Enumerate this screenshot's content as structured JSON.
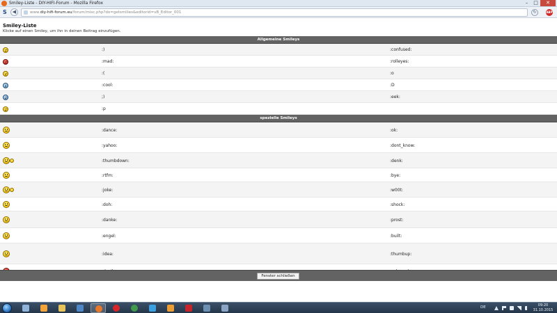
{
  "window": {
    "title": "Smiley-Liste - DIY-HIFI-Forum - Mozilla Firefox",
    "buttons": {
      "minimize": "–",
      "maximize": "□",
      "close": "✕"
    }
  },
  "navbar": {
    "s_label": "S",
    "back_glyph": "◀",
    "url_prefix": "www.",
    "url_domain": "diy-hifi-forum.eu",
    "url_rest": "/forum/misc.php?do=getsmilies&editorid=vB_Editor_001",
    "reload_glyph": "↻",
    "abp_label": "ABP"
  },
  "page": {
    "title": "Smiley-Liste",
    "subtitle": "Klicke auf einen Smiley, um ihn in deinen Beitrag einzufügen.",
    "close_button": "Fenster schließen"
  },
  "sections": [
    {
      "title": "Allgemeine Smileys",
      "rows": [
        {
          "left": {
            "code": ":)",
            "icon": "smile-icon"
          },
          "right": {
            "code": ":confused:",
            "icon": "confused-icon"
          }
        },
        {
          "left": {
            "code": ":mad:",
            "icon": "mad-icon"
          },
          "right": {
            "code": ":rolleyes:",
            "icon": "rolleyes-icon"
          }
        },
        {
          "left": {
            "code": ":(",
            "icon": "frown-icon"
          },
          "right": {
            "code": ":o",
            "icon": "redface-icon"
          }
        },
        {
          "left": {
            "code": ":cool:",
            "icon": "cool-icon"
          },
          "right": {
            "code": ":D",
            "icon": "biggrin-icon"
          }
        },
        {
          "left": {
            "code": ";)",
            "icon": "wink-icon"
          },
          "right": {
            "code": ":eek:",
            "icon": "eek-icon"
          }
        },
        {
          "left": {
            "code": ":p",
            "icon": "tongue-icon"
          },
          "right": {
            "code": "",
            "icon": ""
          }
        }
      ]
    },
    {
      "title": "spezielle Smileys",
      "rows": [
        {
          "left": {
            "code": ":dance:",
            "icon": "dance-icon"
          },
          "right": {
            "code": ":ok:",
            "icon": "ok-icon"
          }
        },
        {
          "left": {
            "code": ":yahoo:",
            "icon": "yahoo-icon"
          },
          "right": {
            "code": ":dont_know:",
            "icon": "dont-know-icon"
          }
        },
        {
          "left": {
            "code": ":thumbdown:",
            "icon": "thumbdown-icon"
          },
          "right": {
            "code": ":denk:",
            "icon": "denk-icon"
          }
        },
        {
          "left": {
            "code": ":rtfm:",
            "icon": "rtfm-icon"
          },
          "right": {
            "code": ":bye:",
            "icon": "bye-icon"
          }
        },
        {
          "left": {
            "code": ":joke:",
            "icon": "joke-icon"
          },
          "right": {
            "code": ":w00t:",
            "icon": "w00t-icon"
          }
        },
        {
          "left": {
            "code": ":doh:",
            "icon": "doh-icon"
          },
          "right": {
            "code": ":shock:",
            "icon": "shock-icon"
          }
        },
        {
          "left": {
            "code": ":danke:",
            "icon": "danke-icon"
          },
          "right": {
            "code": ":prost:",
            "icon": "prost-icon"
          }
        },
        {
          "left": {
            "code": ":engel:",
            "icon": "engel-icon"
          },
          "right": {
            "code": ":built:",
            "icon": "built-icon"
          }
        },
        {
          "left": {
            "code": ":idea:",
            "icon": "idea-icon"
          },
          "right": {
            "code": ":thumbup:",
            "icon": "thumbup-icon"
          }
        },
        {
          "left": {
            "code": ":devil:",
            "icon": "devil-icon"
          },
          "right": {
            "code": ":schnarch:",
            "icon": "schnarch-icon"
          }
        }
      ]
    }
  ],
  "taskbar": {
    "language": "DE",
    "time": "09:20",
    "date": "31.10.2015",
    "apps": [
      "explorer-icon",
      "media-player-icon",
      "folder-icon",
      "thunderbird-icon",
      "firefox-icon",
      "opera-icon",
      "chrome-icon",
      "ie-icon",
      "winamp-icon",
      "acrobat-icon",
      "network-icon",
      "remote-desktop-icon"
    ]
  }
}
